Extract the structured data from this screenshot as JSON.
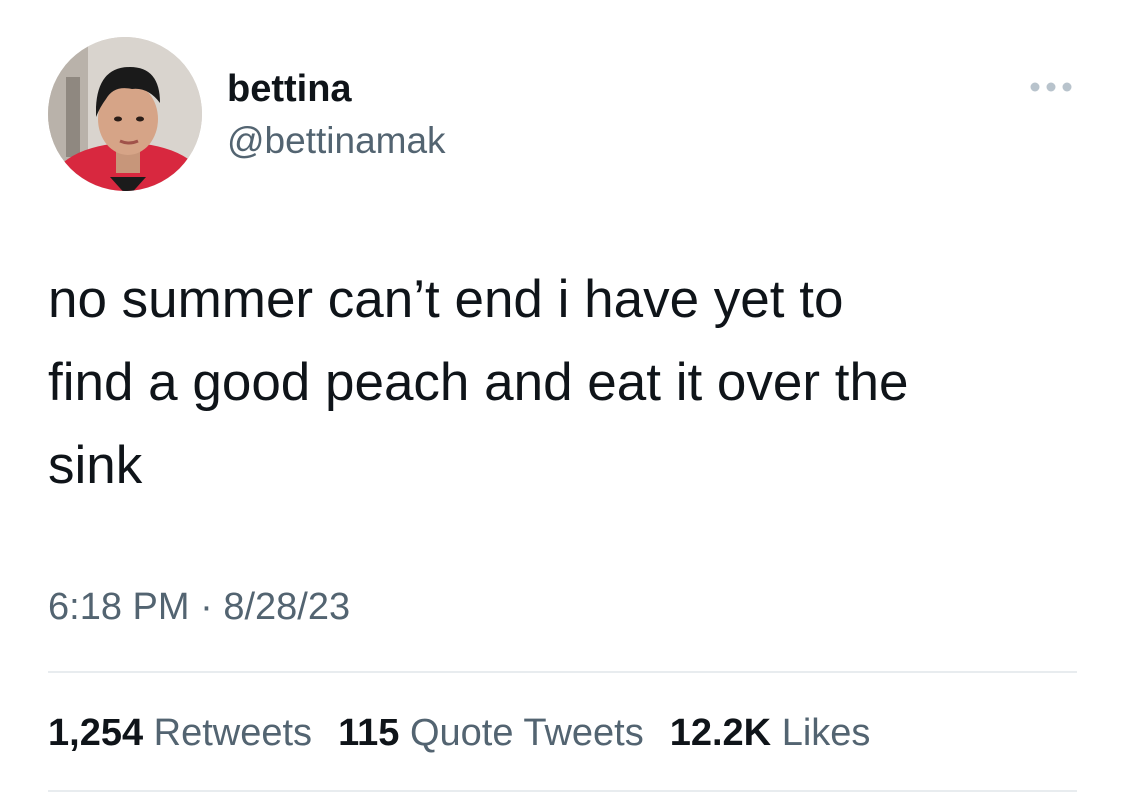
{
  "author": {
    "display_name": "bettina",
    "handle": "@bettinamak",
    "avatar_icon": "profile-photo-avatar"
  },
  "more_icon": "more-options-icon",
  "tweet": {
    "text": "no summer can’t end i have yet to\nfind a good peach and eat it over the\nsink",
    "time": "6:18 PM",
    "separator": " · ",
    "date": "8/28/23"
  },
  "stats": {
    "retweets_count": "1,254",
    "retweets_label": "Retweets",
    "quote_tweets_count": "115",
    "quote_tweets_label": "Quote Tweets",
    "likes_count": "12.2K",
    "likes_label": "Likes"
  },
  "colors": {
    "text_primary": "#0f1419",
    "text_secondary": "#536471",
    "divider": "#e8ecef",
    "background": "#ffffff"
  }
}
